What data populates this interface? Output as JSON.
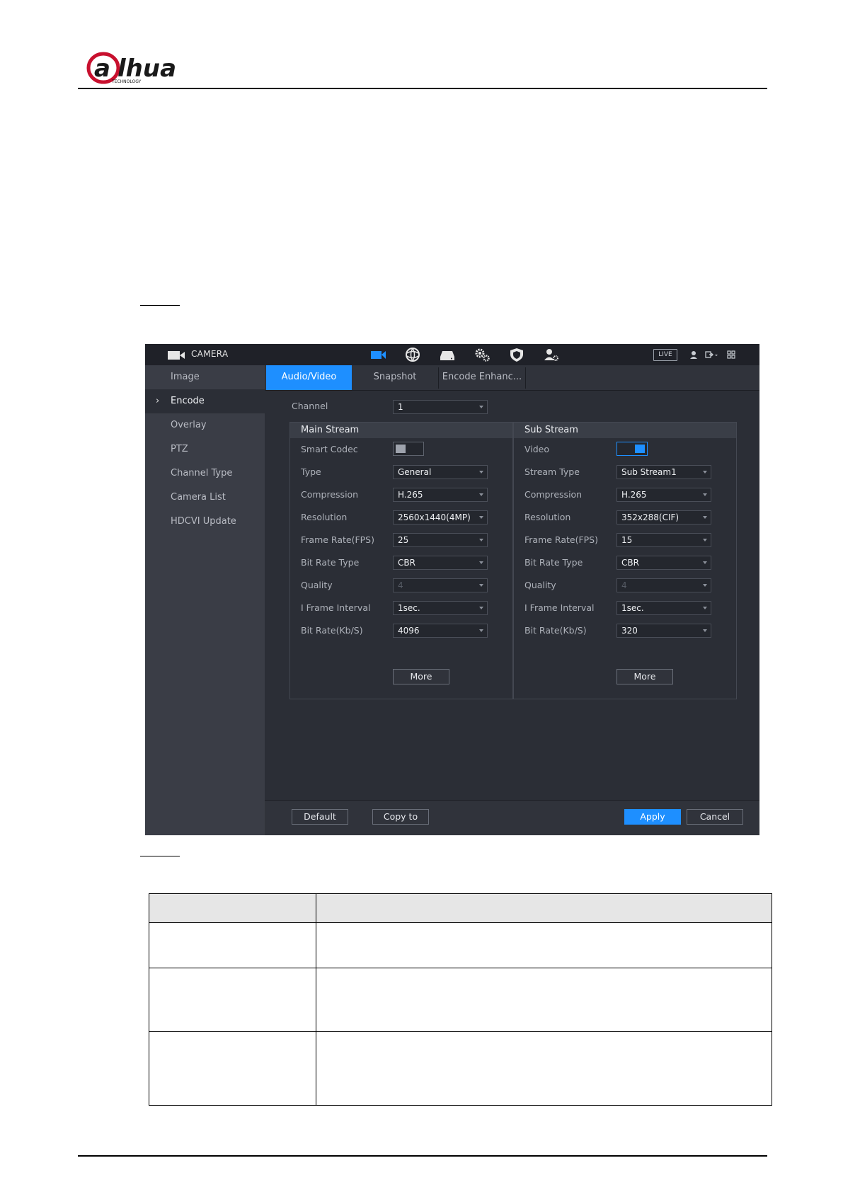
{
  "brand": {
    "logo_text": "alhua",
    "logo_subtext": "TECHNOLOGY",
    "logo_color": "#c8102e"
  },
  "ui": {
    "window_title": "CAMERA",
    "top_icons": [
      "camera-icon",
      "network-icon",
      "storage-icon",
      "system-icon",
      "security-icon",
      "account-icon"
    ],
    "live_badge": "LIVE",
    "sidebar": [
      {
        "label": "Image",
        "active": false
      },
      {
        "label": "Encode",
        "active": true
      },
      {
        "label": "Overlay",
        "active": false
      },
      {
        "label": "PTZ",
        "active": false
      },
      {
        "label": "Channel Type",
        "active": false
      },
      {
        "label": "Camera List",
        "active": false
      },
      {
        "label": "HDCVI Update",
        "active": false
      }
    ],
    "tabs": [
      {
        "label": "Audio/Video",
        "active": true
      },
      {
        "label": "Snapshot",
        "active": false
      },
      {
        "label": "Encode Enhanc...",
        "active": false
      }
    ],
    "channel": {
      "label": "Channel",
      "value": "1"
    },
    "main_stream": {
      "title": "Main Stream",
      "smart_codec_label": "Smart Codec",
      "smart_codec_enabled": false,
      "fields": [
        {
          "label": "Type",
          "value": "General",
          "disabled": false
        },
        {
          "label": "Compression",
          "value": "H.265",
          "disabled": false
        },
        {
          "label": "Resolution",
          "value": "2560x1440(4MP)",
          "disabled": false
        },
        {
          "label": "Frame Rate(FPS)",
          "value": "25",
          "disabled": false
        },
        {
          "label": "Bit Rate Type",
          "value": "CBR",
          "disabled": false
        },
        {
          "label": "Quality",
          "value": "4",
          "disabled": true
        },
        {
          "label": "I Frame Interval",
          "value": "1sec.",
          "disabled": false
        },
        {
          "label": "Bit Rate(Kb/S)",
          "value": "4096",
          "disabled": false
        }
      ],
      "more_label": "More"
    },
    "sub_stream": {
      "title": "Sub Stream",
      "video_label": "Video",
      "video_enabled": true,
      "fields": [
        {
          "label": "Stream Type",
          "value": "Sub Stream1",
          "disabled": false
        },
        {
          "label": "Compression",
          "value": "H.265",
          "disabled": false
        },
        {
          "label": "Resolution",
          "value": "352x288(CIF)",
          "disabled": false
        },
        {
          "label": "Frame Rate(FPS)",
          "value": "15",
          "disabled": false
        },
        {
          "label": "Bit Rate Type",
          "value": "CBR",
          "disabled": false
        },
        {
          "label": "Quality",
          "value": "4",
          "disabled": true
        },
        {
          "label": "I Frame Interval",
          "value": "1sec.",
          "disabled": false
        },
        {
          "label": "Bit Rate(Kb/S)",
          "value": "320",
          "disabled": false
        }
      ],
      "more_label": "More"
    },
    "buttons": {
      "default": "Default",
      "copy_to": "Copy to",
      "apply": "Apply",
      "cancel": "Cancel"
    },
    "accent_color": "#1e8fff"
  }
}
